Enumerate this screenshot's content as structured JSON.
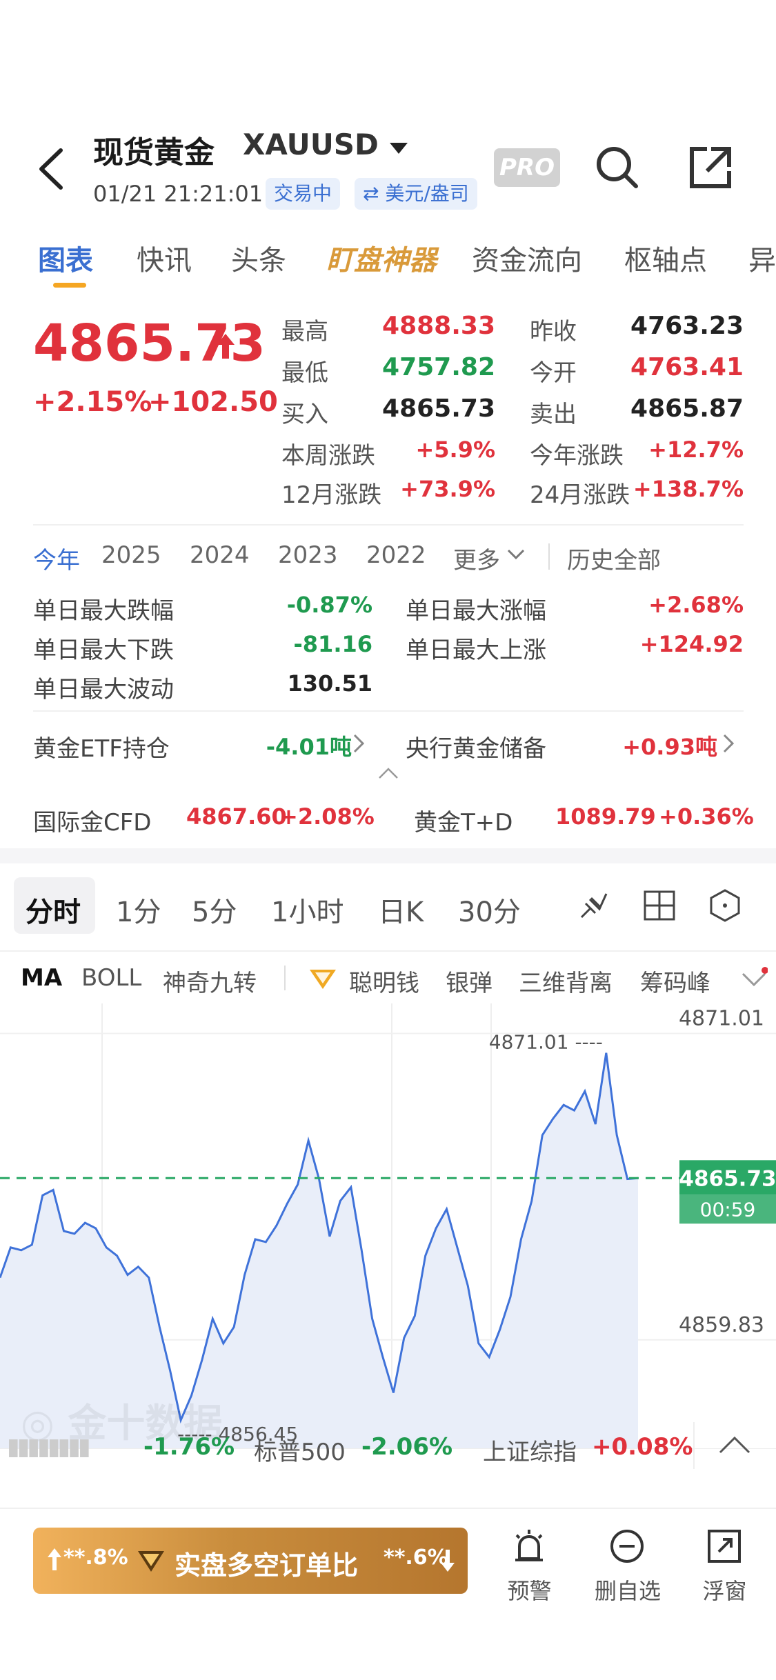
{
  "header": {
    "title": "现货黄金",
    "symbol": "XAUUSD",
    "datetime": "01/21 21:21:01",
    "status_badge": "交易中",
    "unit_badge": "⇄ 美元/盎司",
    "pro_label": "PRO"
  },
  "tabs": [
    "图表",
    "快讯",
    "头条",
    "盯盘神器",
    "资金流向",
    "枢轴点",
    "异"
  ],
  "quote": {
    "price": "4865.73",
    "change_pct": "+2.15%",
    "change": "+102.50",
    "high_label": "最高",
    "high": "4888.33",
    "prev_close_label": "昨收",
    "prev_close": "4763.23",
    "low_label": "最低",
    "low": "4757.82",
    "open_label": "今开",
    "open": "4763.41",
    "bid_label": "买入",
    "bid": "4865.73",
    "ask_label": "卖出",
    "ask": "4865.87",
    "week_label": "本周涨跌",
    "week": "+5.9%",
    "ytd_label": "今年涨跌",
    "ytd": "+12.7%",
    "m12_label": "12月涨跌",
    "m12": "+73.9%",
    "m24_label": "24月涨跌",
    "m24": "+138.7%"
  },
  "periods": {
    "items": [
      "今年",
      "2025",
      "2024",
      "2023",
      "2022"
    ],
    "more": "更多",
    "all": "历史全部"
  },
  "stats": {
    "max_drop_pct_label": "单日最大跌幅",
    "max_drop_pct": "-0.87%",
    "max_rise_pct_label": "单日最大涨幅",
    "max_rise_pct": "+2.68%",
    "max_drop_label": "单日最大下跌",
    "max_drop": "-81.16",
    "max_rise_label": "单日最大上涨",
    "max_rise": "+124.92",
    "max_vol_label": "单日最大波动",
    "max_vol": "130.51",
    "etf_label": "黄金ETF持仓",
    "etf": "-4.01吨",
    "cb_label": "央行黄金储备",
    "cb": "+0.93吨",
    "cfd_label": "国际金CFD",
    "cfd_price": "4867.60",
    "cfd_pct": "+2.08%",
    "td_label": "黄金T+D",
    "td_price": "1089.79",
    "td_pct": "+0.36%"
  },
  "chart_tabs": [
    "分时",
    "1分",
    "5分",
    "1小时",
    "日K",
    "30分"
  ],
  "indicators": [
    "MA",
    "BOLL",
    "神奇九转",
    "聪明钱",
    "银弹",
    "三维背离",
    "筹码峰"
  ],
  "chart_data": {
    "type": "line",
    "y_ticks": [
      "4871.01",
      "4859.83"
    ],
    "last_price": "4865.73",
    "countdown": "00:59",
    "max_marker": "4871.01",
    "min_marker": "4856.45",
    "ylim": [
      4856.0,
      4871.6
    ],
    "values": [
      4862.1,
      4863.2,
      4863.1,
      4863.3,
      4865.1,
      4865.3,
      4863.8,
      4863.7,
      4864.1,
      4863.9,
      4863.2,
      4862.9,
      4862.2,
      4862.5,
      4862.1,
      4860.3,
      4858.7,
      4856.9,
      4857.8,
      4859.1,
      4860.6,
      4859.7,
      4860.3,
      4862.2,
      4863.5,
      4863.4,
      4864.0,
      4864.8,
      4865.5,
      4867.1,
      4865.7,
      4863.6,
      4864.9,
      4865.4,
      4863.1,
      4860.6,
      4859.2,
      4857.9,
      4859.9,
      4860.7,
      4862.9,
      4863.9,
      4864.6,
      4863.2,
      4861.8,
      4859.7,
      4859.2,
      4860.2,
      4861.4,
      4863.5,
      4864.9,
      4867.3,
      4867.9,
      4868.4,
      4868.2,
      4868.9,
      4867.7,
      4870.3,
      4867.3,
      4865.7,
      4865.73
    ],
    "colors": {
      "line": "#3f72d9",
      "fill": "#e9eef9",
      "dashed": "#2aa866",
      "label_bg": "#2aa866"
    }
  },
  "ticker": {
    "a_label": "▮▮▮▮▮▮▮▮",
    "a_pct": "-1.76%",
    "b_label": "标普500",
    "b_pct": "-2.06%",
    "c_label": "上证综指",
    "c_pct": "+0.08%"
  },
  "bottom": {
    "promo_left": "**.8%",
    "promo_text": "实盘多空订单比",
    "promo_right": "**.6%",
    "alert": "预警",
    "remove": "删自选",
    "float": "浮窗"
  }
}
